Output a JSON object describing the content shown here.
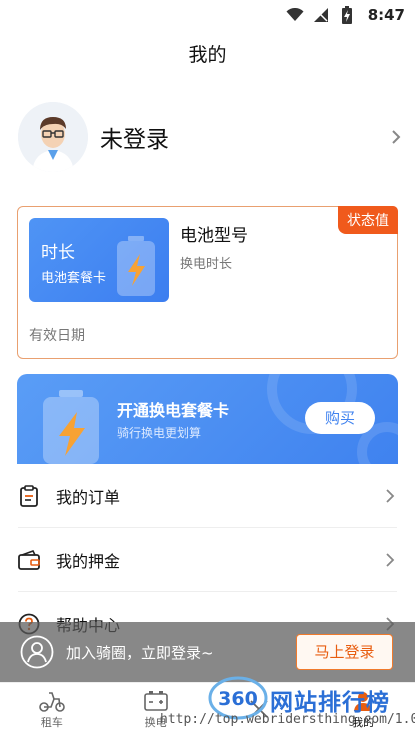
{
  "status_bar": {
    "time": "8:47",
    "icons": [
      "wifi-icon",
      "signal-icon",
      "battery-charging-icon"
    ]
  },
  "header": {
    "title": "我的"
  },
  "profile": {
    "name": "未登录",
    "avatar_icon": "avatar-icon"
  },
  "battery_card": {
    "status_badge": "状态值",
    "duration_title": "时长",
    "package_label": "电池套餐卡",
    "battery_model": "电池型号",
    "swap_duration": "换电时长",
    "valid_date": "有效日期"
  },
  "promo": {
    "title": "开通换电套餐卡",
    "subtitle": "骑行换电更划算",
    "buy_label": "购买"
  },
  "menu": {
    "items": [
      {
        "label": "我的订单",
        "icon": "order-icon"
      },
      {
        "label": "我的押金",
        "icon": "wallet-icon"
      },
      {
        "label": "帮助中心",
        "icon": "help-icon"
      }
    ]
  },
  "login_bar": {
    "prompt": "加入骑圈，立即登录~",
    "button": "马上登录"
  },
  "tabbar": {
    "tabs": [
      {
        "label": "租车",
        "icon": "scooter-icon"
      },
      {
        "label": "换电",
        "icon": "battery-swap-icon"
      },
      {
        "label": "",
        "icon": "tools-icon"
      },
      {
        "label": "我的",
        "icon": "user-icon"
      }
    ]
  },
  "watermark": {
    "logo_text": "360",
    "text": "网站排行榜",
    "url": "http://top.webridersthing.com/1.0"
  },
  "colors": {
    "accent_blue": "#3f82ef",
    "badge_orange": "#f05a1c",
    "card_border": "#e9a070"
  }
}
